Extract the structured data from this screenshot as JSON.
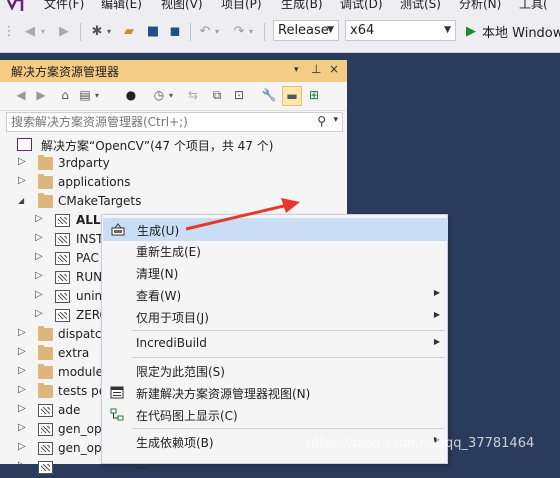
{
  "menubar": {
    "items": [
      "文件(F)",
      "编辑(E)",
      "视图(V)",
      "项目(P)",
      "生成(B)",
      "调试(D)",
      "测试(S)",
      "分析(N)",
      "工具("
    ]
  },
  "toolbar": {
    "configuration": "Release",
    "platform": "x64",
    "run_label": "本地 Windows"
  },
  "solution_explorer": {
    "title": "解决方案资源管理器",
    "title_controls": [
      "▾",
      "ᵖ",
      "×"
    ],
    "search_placeholder": "搜索解决方案资源管理器(Ctrl+;)",
    "tree": [
      {
        "label": "解决方案“OpenCV”(47 个项目，共 47 个)",
        "icon": "solution-icon",
        "expander": ""
      },
      {
        "label": "3rdparty",
        "icon": "folder-icon",
        "expander": "▷"
      },
      {
        "label": "applications",
        "icon": "folder-icon",
        "expander": "▷"
      },
      {
        "label": "CMakeTargets",
        "icon": "folder-icon",
        "expander": "◢"
      },
      {
        "label": "ALL",
        "icon": "project-icon",
        "expander": "▷"
      },
      {
        "label": "INST",
        "icon": "project-icon",
        "expander": "▷"
      },
      {
        "label": "PAC",
        "icon": "project-icon",
        "expander": "▷"
      },
      {
        "label": "RUN",
        "icon": "project-icon",
        "expander": "▷"
      },
      {
        "label": "unin",
        "icon": "project-icon",
        "expander": "▷"
      },
      {
        "label": "ZERC",
        "icon": "project-icon",
        "expander": "▷"
      },
      {
        "label": "dispatc",
        "icon": "folder-icon",
        "expander": "▷"
      },
      {
        "label": "extra",
        "icon": "folder-icon",
        "expander": "▷"
      },
      {
        "label": "module",
        "icon": "folder-icon",
        "expander": "▷"
      },
      {
        "label": "tests pe",
        "icon": "folder-icon",
        "expander": "▷"
      },
      {
        "label": "ade",
        "icon": "project-icon",
        "expander": "▷"
      },
      {
        "label": "gen_op",
        "icon": "project-icon",
        "expander": "▷"
      },
      {
        "label": "gen_op",
        "icon": "project-icon",
        "expander": "▷"
      }
    ]
  },
  "context_menu": {
    "items": [
      {
        "label": "生成(U)",
        "icon": "build-icon",
        "highlighted": true,
        "submenu": false
      },
      {
        "label": "重新生成(E)",
        "icon": "",
        "highlighted": false,
        "submenu": false
      },
      {
        "label": "清理(N)",
        "icon": "",
        "highlighted": false,
        "submenu": false
      },
      {
        "label": "查看(W)",
        "icon": "",
        "highlighted": false,
        "submenu": true
      },
      {
        "label": "仅用于项目(J)",
        "icon": "",
        "highlighted": false,
        "submenu": true
      },
      {
        "label": "IncrediBuild",
        "icon": "",
        "highlighted": false,
        "submenu": true
      },
      {
        "label": "限定为此范围(S)",
        "icon": "",
        "highlighted": false,
        "submenu": false
      },
      {
        "label": "新建解决方案资源管理器视图(N)",
        "icon": "new-view-icon",
        "highlighted": false,
        "submenu": false
      },
      {
        "label": "在代码图上显示(C)",
        "icon": "code-map-icon",
        "highlighted": false,
        "submenu": false
      },
      {
        "label": "生成依赖项(B)",
        "icon": "",
        "highlighted": false,
        "submenu": true
      }
    ]
  },
  "watermark": "https://blog.csdn.net/qq_37781464",
  "colors": {
    "title_active": "#f5cc84",
    "menu_highlight": "#c9def5",
    "arrow": "#e8372c",
    "run_icon": "#1e8a2f",
    "vs_logo": "#68217a"
  }
}
